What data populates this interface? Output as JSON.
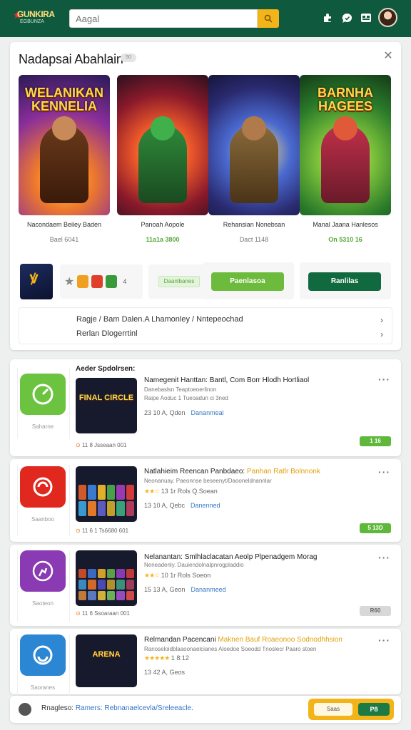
{
  "header": {
    "logo_line1": "GUNKIRA",
    "logo_line2": "EGBUNZA",
    "search_placeholder": "Aagal",
    "icons": [
      "search-icon",
      "puzzle-icon",
      "chat-icon",
      "grid-icon",
      "avatar"
    ]
  },
  "featured": {
    "title": "Nadapsai Abahlain",
    "pill": "50",
    "games": [
      {
        "art_title": "WELANIKAN KENNELIA",
        "name": "Nacondaem Beiley Baden",
        "price": "Bael 6041",
        "price_style": "muted"
      },
      {
        "art_title": "",
        "name": "Panoah Aopole",
        "price": "11a1a 3800",
        "price_style": "green"
      },
      {
        "art_title": "",
        "name": "Rehansian Nonebsan",
        "price": "Dact 1148",
        "price_style": "muted"
      },
      {
        "art_title": "BARNHA HAGEES",
        "name": "Manal Jaana Hanlesos",
        "price": "On 5310 16",
        "price_style": "green"
      }
    ],
    "mini_text": "4",
    "tag_label": "Daanlbanes",
    "primary_button": "Paenlasoa",
    "secondary_button": "Ranlilas",
    "links": [
      "Ragje / Bam Dalen.A Lhamonley / Nntepeochad",
      "Rerlan Dlogerrtinl"
    ],
    "colors": {
      "primary": "#6cbb3c",
      "secondary": "#116a3f"
    }
  },
  "list_heading": "Aeder Spdolrsen:",
  "list": [
    {
      "title": "Namegenit Hanttan: Bantl, Com Borr Hlodh Hortliaol",
      "title_hl": "",
      "sub": "Danebaslsn Teaptoeoerlinon",
      "sub2": "Raipe Aoduc 1 Tueoadun ci 3ned",
      "meta": "23 10 A, Qden",
      "link": "Dananmeal",
      "stars": "",
      "foot": "11 8 Jsseaan 001",
      "badge": "1 16",
      "side": "Saharne",
      "accent": "#6cc33f"
    },
    {
      "title": "Natlahieim Reencan Panbdaeo: ",
      "title_hl": "Panhan Ratlr Bolnnonk",
      "sub": "Neonanuay. Paeonnse beseenyt/Daooneldnannlar",
      "sub2": "",
      "meta": "13 10 A, Qebc",
      "link": "Danenned",
      "stars": "★★☆",
      "stars_text": "13 1r  Rols   Q.Soean",
      "foot": "11 6 1 Ts6680 601",
      "badge": "5 13D",
      "side": "Saanboo",
      "accent": "#e0281f"
    },
    {
      "title": "Nelanantan: Smlhlaclacatan Aeolp Plpenadgem Morag",
      "title_hl": "",
      "sub": "Neneadenly. Dauiendolnalpnrogpladdio",
      "sub2": "",
      "meta": "15 13 A, Geon",
      "link": "Dananmeed",
      "stars": "★★☆",
      "stars_text": "10 1r  Rols   Soeon",
      "foot": "11 6 Ssoaraan 001",
      "badge": "R60",
      "side": "Saoteon",
      "accent": "#8a3ab2"
    },
    {
      "title": "Relmandan Pacencani ",
      "title_hl": "Maknen Bauf Roaeonoo Sodnodhhsion",
      "sub": "Ranoseloidblaaoonaelcianes Aloedoe Soeodd Tnoslecr Paaro stoen",
      "sub2": "",
      "meta": "13 42 A, Geos",
      "link": "Dananeaeld",
      "stars": "★★★★★",
      "stars_text": "1 8:12",
      "foot": "",
      "badge": "",
      "side": "Saoranes",
      "accent": "#2b86d4"
    }
  ],
  "bottom_bar": {
    "label": "Rnagleso: ",
    "link": "Ramers: Rebnanaelcevla/Sreleeacle.",
    "pill_left": "Saas",
    "pill_right": "P8"
  }
}
